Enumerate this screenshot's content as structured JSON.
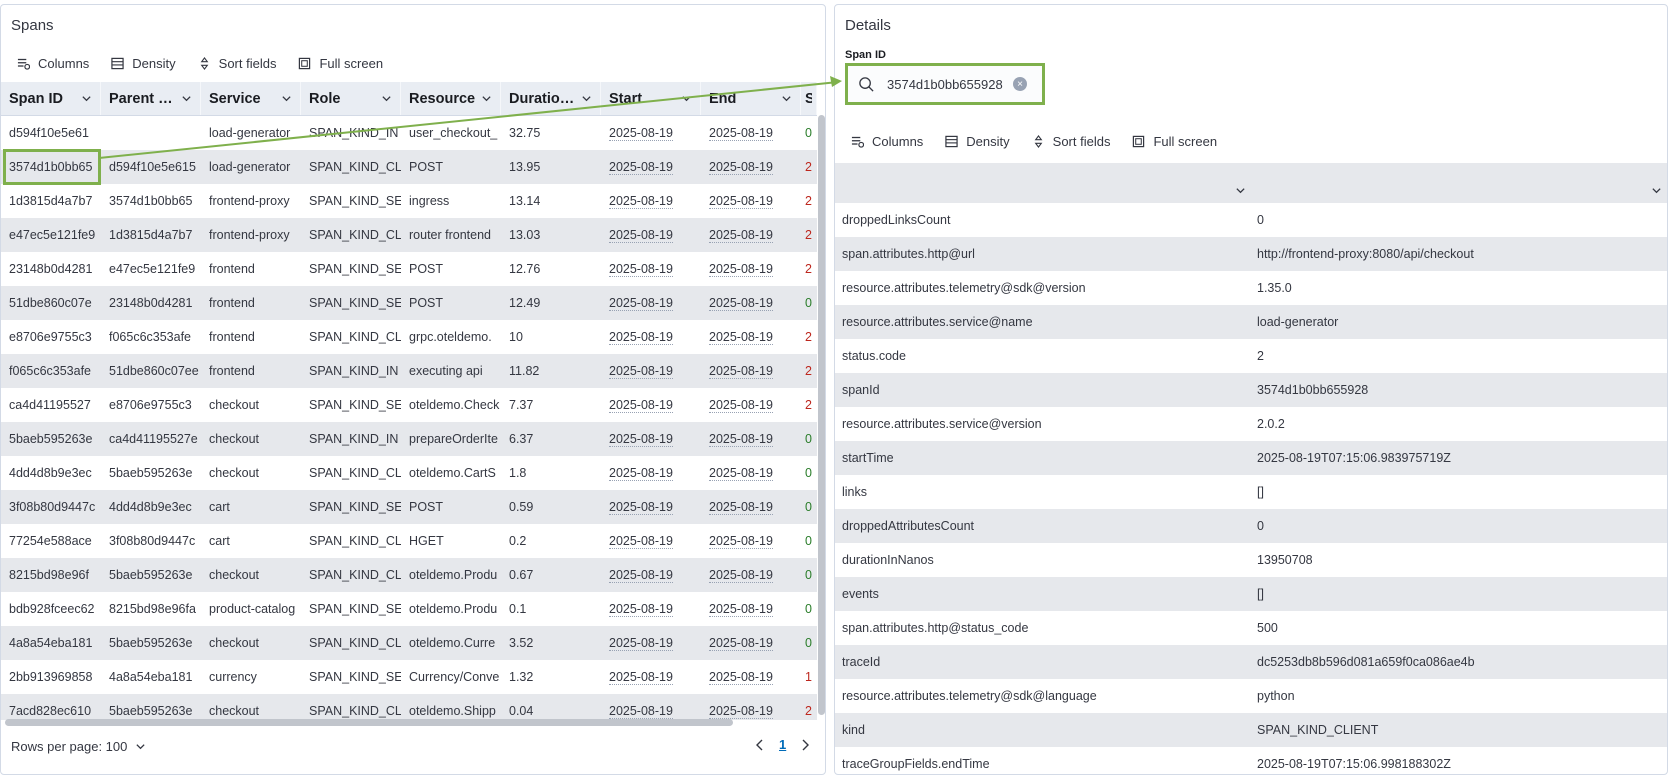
{
  "left": {
    "title": "Spans",
    "toolbar": {
      "columns": "Columns",
      "density": "Density",
      "sort": "Sort fields",
      "fullscreen": "Full screen"
    },
    "columns": [
      "Span ID",
      "Parent S...",
      "Service",
      "Role",
      "Resource",
      "Duration,...",
      "Start",
      "End",
      "S"
    ],
    "rows": [
      [
        "d594f10e5e61",
        "",
        "load-generator",
        "SPAN_KIND_IN",
        "user_checkout_",
        "32.75",
        "2025-08-19",
        "2025-08-19",
        "0"
      ],
      [
        "3574d1b0bb65",
        "d594f10e5e615",
        "load-generator",
        "SPAN_KIND_CLI",
        "POST",
        "13.95",
        "2025-08-19",
        "2025-08-19",
        "2"
      ],
      [
        "1d3815d4a7b7",
        "3574d1b0bb65",
        "frontend-proxy",
        "SPAN_KIND_SE",
        "ingress",
        "13.14",
        "2025-08-19",
        "2025-08-19",
        "2"
      ],
      [
        "e47ec5e121fe9",
        "1d3815d4a7b7",
        "frontend-proxy",
        "SPAN_KIND_CLI",
        "router frontend",
        "13.03",
        "2025-08-19",
        "2025-08-19",
        "2"
      ],
      [
        "23148b0d4281",
        "e47ec5e121fe9",
        "frontend",
        "SPAN_KIND_SE",
        "POST",
        "12.76",
        "2025-08-19",
        "2025-08-19",
        "2"
      ],
      [
        "51dbe860c07e",
        "23148b0d4281",
        "frontend",
        "SPAN_KIND_SE",
        "POST",
        "12.49",
        "2025-08-19",
        "2025-08-19",
        "0"
      ],
      [
        "e8706e9755c3",
        "f065c6c353afe",
        "frontend",
        "SPAN_KIND_CLI",
        "grpc.oteldemo.",
        "10",
        "2025-08-19",
        "2025-08-19",
        "2"
      ],
      [
        "f065c6c353afe",
        "51dbe860c07ee",
        "frontend",
        "SPAN_KIND_IN",
        "executing api",
        "11.82",
        "2025-08-19",
        "2025-08-19",
        "2"
      ],
      [
        "ca4d41195527",
        "e8706e9755c3",
        "checkout",
        "SPAN_KIND_SE",
        "oteldemo.Check",
        "7.37",
        "2025-08-19",
        "2025-08-19",
        "2"
      ],
      [
        "5baeb595263e",
        "ca4d41195527e",
        "checkout",
        "SPAN_KIND_IN",
        "prepareOrderIte",
        "6.37",
        "2025-08-19",
        "2025-08-19",
        "0"
      ],
      [
        "4dd4d8b9e3ec",
        "5baeb595263e",
        "checkout",
        "SPAN_KIND_CLI",
        "oteldemo.CartS",
        "1.8",
        "2025-08-19",
        "2025-08-19",
        "0"
      ],
      [
        "3f08b80d9447c",
        "4dd4d8b9e3ec",
        "cart",
        "SPAN_KIND_SE",
        "POST",
        "0.59",
        "2025-08-19",
        "2025-08-19",
        "0"
      ],
      [
        "77254e588ace",
        "3f08b80d9447c",
        "cart",
        "SPAN_KIND_CLI",
        "HGET",
        "0.2",
        "2025-08-19",
        "2025-08-19",
        "0"
      ],
      [
        "8215bd98e96f",
        "5baeb595263e",
        "checkout",
        "SPAN_KIND_CLI",
        "oteldemo.Produ",
        "0.67",
        "2025-08-19",
        "2025-08-19",
        "0"
      ],
      [
        "bdb928fceec62",
        "8215bd98e96fa",
        "product-catalog",
        "SPAN_KIND_SE",
        "oteldemo.Produ",
        "0.1",
        "2025-08-19",
        "2025-08-19",
        "0"
      ],
      [
        "4a8a54eba181",
        "5baeb595263e",
        "checkout",
        "SPAN_KIND_CLI",
        "oteldemo.Curre",
        "3.52",
        "2025-08-19",
        "2025-08-19",
        "0"
      ],
      [
        "2bb913969858",
        "4a8a54eba181",
        "currency",
        "SPAN_KIND_SE",
        "Currency/Conve",
        "1.32",
        "2025-08-19",
        "2025-08-19",
        "1"
      ],
      [
        "7acd828ec610",
        "5baeb595263e",
        "checkout",
        "SPAN_KIND_CLI",
        "oteldemo.Shipp",
        "0.04",
        "2025-08-19",
        "2025-08-19",
        "2"
      ]
    ],
    "footer": {
      "rows_per_page": "Rows per page: 100",
      "page": "1"
    }
  },
  "right": {
    "title": "Details",
    "field_label": "Span ID",
    "search_value": "3574d1b0bb655928",
    "toolbar": {
      "columns": "Columns",
      "density": "Density",
      "sort": "Sort fields",
      "fullscreen": "Full screen"
    },
    "rows": [
      [
        "droppedLinksCount",
        "0"
      ],
      [
        "span.attributes.http@url",
        "http://frontend-proxy:8080/api/checkout"
      ],
      [
        "resource.attributes.telemetry@sdk@version",
        "1.35.0"
      ],
      [
        "resource.attributes.service@name",
        "load-generator"
      ],
      [
        "status.code",
        "2"
      ],
      [
        "spanId",
        "3574d1b0bb655928"
      ],
      [
        "resource.attributes.service@version",
        "2.0.2"
      ],
      [
        "startTime",
        "2025-08-19T07:15:06.983975719Z"
      ],
      [
        "links",
        "[]"
      ],
      [
        "droppedAttributesCount",
        "0"
      ],
      [
        "durationInNanos",
        "13950708"
      ],
      [
        "events",
        "[]"
      ],
      [
        "span.attributes.http@status_code",
        "500"
      ],
      [
        "traceId",
        "dc5253db8b596d081a659f0ca086ae4b"
      ],
      [
        "resource.attributes.telemetry@sdk@language",
        "python"
      ],
      [
        "kind",
        "SPAN_KIND_CLIENT"
      ],
      [
        "traceGroupFields.endTime",
        "2025-08-19T07:15:06.998188302Z"
      ]
    ]
  },
  "colors": {
    "highlight": "#7fb04c",
    "error_status": "#bd271e",
    "ok_status": "#2a7d2a"
  }
}
